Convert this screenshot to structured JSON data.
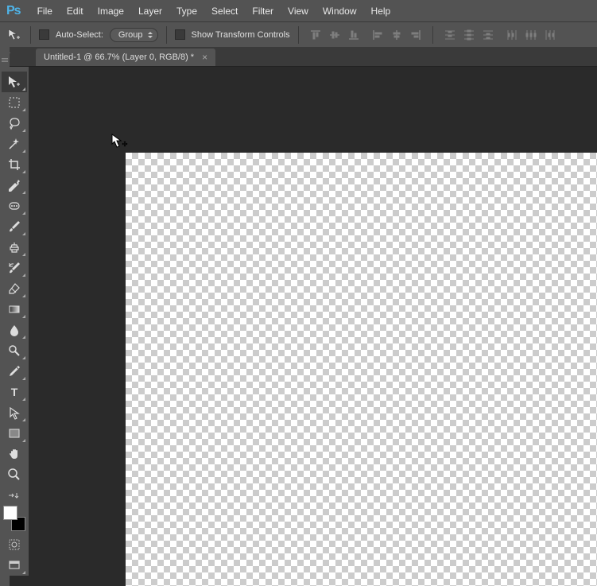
{
  "app": {
    "logo": "Ps"
  },
  "menu": [
    "File",
    "Edit",
    "Image",
    "Layer",
    "Type",
    "Select",
    "Filter",
    "View",
    "Window",
    "Help"
  ],
  "options": {
    "auto_select_label": "Auto-Select:",
    "auto_select_mode": "Group",
    "show_transform_label": "Show Transform Controls"
  },
  "tab": {
    "title": "Untitled-1 @ 66.7% (Layer 0, RGB/8) *"
  },
  "tools": [
    {
      "name": "move-tool",
      "active": true
    },
    {
      "name": "marquee-tool"
    },
    {
      "name": "lasso-tool"
    },
    {
      "name": "magic-wand-tool"
    },
    {
      "name": "crop-tool"
    },
    {
      "name": "eyedropper-tool"
    },
    {
      "name": "healing-brush-tool"
    },
    {
      "name": "brush-tool"
    },
    {
      "name": "clone-stamp-tool"
    },
    {
      "name": "history-brush-tool"
    },
    {
      "name": "eraser-tool"
    },
    {
      "name": "gradient-tool"
    },
    {
      "name": "blur-tool"
    },
    {
      "name": "dodge-tool"
    },
    {
      "name": "pen-tool"
    },
    {
      "name": "type-tool"
    },
    {
      "name": "path-selection-tool"
    },
    {
      "name": "rectangle-tool"
    },
    {
      "name": "hand-tool"
    },
    {
      "name": "zoom-tool"
    }
  ],
  "colors": {
    "foreground": "#ffffff",
    "background": "#000000"
  }
}
